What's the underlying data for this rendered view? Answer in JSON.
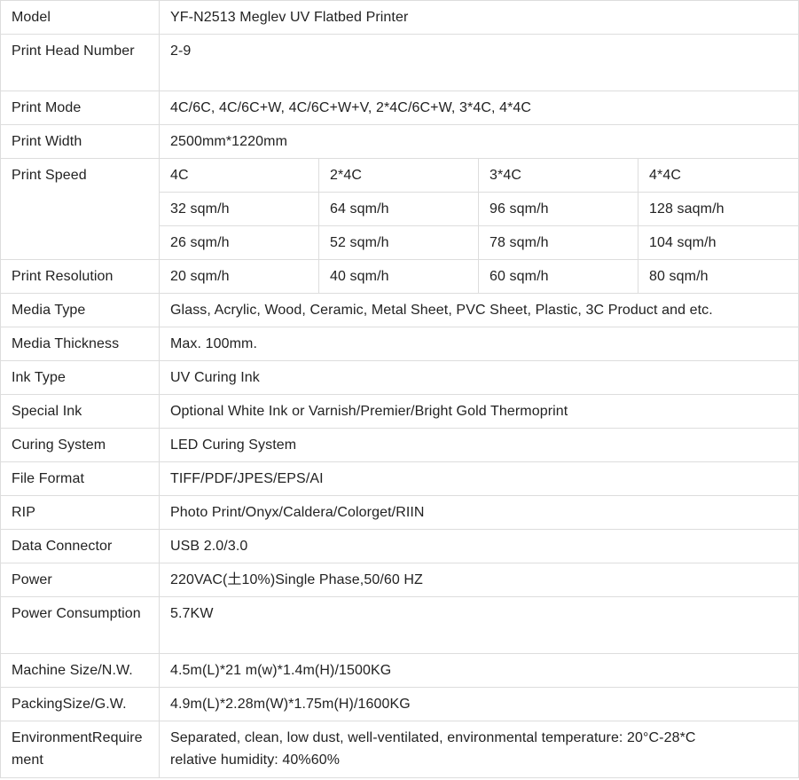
{
  "rows": {
    "model": {
      "label": "Model",
      "value": "YF-N2513 Meglev UV Flatbed Printer"
    },
    "print_head_number": {
      "label": "Print Head Number",
      "value": "2-9"
    },
    "print_mode": {
      "label": "Print Mode",
      "value": "4C/6C, 4C/6C+W, 4C/6C+W+V, 2*4C/6C+W, 3*4C, 4*4C"
    },
    "print_width": {
      "label": "Print Width",
      "value": "2500mm*1220mm"
    },
    "print_speed": {
      "label": "Print Speed",
      "headers": [
        "4C",
        "2*4C",
        "3*4C",
        "4*4C"
      ],
      "rows": [
        [
          "32 sqm/h",
          "64 sqm/h",
          "96 sqm/h",
          "128 saqm/h"
        ],
        [
          "26 sqm/h",
          "52 sqm/h",
          "78 sqm/h",
          "104 sqm/h"
        ]
      ]
    },
    "print_resolution": {
      "label": "Print Resolution",
      "values": [
        "20 sqm/h",
        "40 sqm/h",
        "60 sqm/h",
        "80 sqm/h"
      ]
    },
    "media_type": {
      "label": "Media Type",
      "value": "Glass, Acrylic, Wood, Ceramic, Metal Sheet, PVC Sheet, Plastic, 3C Product and etc."
    },
    "media_thickness": {
      "label": "Media Thickness",
      "value": "Max. 100mm."
    },
    "ink_type": {
      "label": "Ink Type",
      "value": "UV Curing Ink"
    },
    "special_ink": {
      "label": "Special Ink",
      "value": "Optional White Ink or Varnish/Premier/Bright Gold Thermoprint"
    },
    "curing_system": {
      "label": "Curing System",
      "value": "LED Curing System"
    },
    "file_format": {
      "label": "File Format",
      "value": "TIFF/PDF/JPES/EPS/AI"
    },
    "rip": {
      "label": "RIP",
      "value": "Photo Print/Onyx/Caldera/Colorget/RIIN"
    },
    "data_connector": {
      "label": "Data Connector",
      "value": "USB 2.0/3.0"
    },
    "power": {
      "label": "Power",
      "value": "220VAC(土10%)Single Phase,50/60 HZ"
    },
    "power_consumption": {
      "label": "Power Consumption",
      "value": "5.7KW"
    },
    "machine_size": {
      "label": "Machine Size/N.W.",
      "value": "4.5m(L)*21 m(w)*1.4m(H)/1500KG"
    },
    "packing_size": {
      "label": "PackingSize/G.W.",
      "value": "4.9m(L)*2.28m(W)*1.75m(H)/1600KG"
    },
    "environment": {
      "label": "EnvironmentRequirement",
      "value_line1": "Separated, clean, low dust, well-ventilated, environmental temperature: 20°C-28*C",
      "value_line2": "relative humidity: 40%60%"
    }
  }
}
